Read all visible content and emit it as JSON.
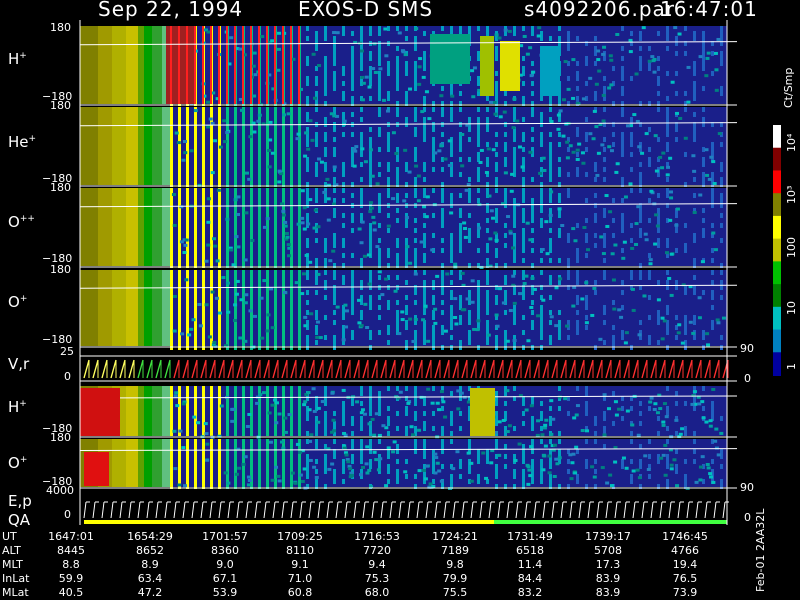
{
  "header": {
    "date": "Sep 22, 1994",
    "instrument": "EXOS-D SMS",
    "file": "s4092206.par",
    "time": "16:47:01"
  },
  "panels": {
    "h_plus": {
      "name": "H",
      "sup": "+",
      "ymax": "180",
      "ymin": "−180"
    },
    "he_plus": {
      "name": "He",
      "sup": "+",
      "ymax": "180",
      "ymin": "−180"
    },
    "o_pp": {
      "name": "O",
      "sup": "++",
      "ymax": "180",
      "ymin": "−180"
    },
    "o_plus": {
      "name": "O",
      "sup": "+",
      "ymax": "180",
      "ymin": "−180"
    },
    "vr": {
      "name": "V,r",
      "ymax": "25",
      "ymin": "0",
      "rmax": "90",
      "rmin": "0"
    },
    "h_plus2": {
      "name": "H",
      "sup": "+",
      "ymax": "180",
      "ymin": "−180"
    },
    "o_plus2": {
      "name": "O",
      "sup": "+",
      "ymax": "180",
      "ymin": "−180",
      "rmax": "90"
    },
    "ep": {
      "name1": "E,p",
      "name2": "QA",
      "ymax": "4000",
      "ymin": "0",
      "rmin": "0"
    }
  },
  "colorbar": {
    "unit": "Ct/Smp",
    "ticks": [
      "10⁴",
      "10³",
      "100",
      "10",
      "1"
    ],
    "colors": [
      "#ffffff",
      "#800000",
      "#ff0000",
      "#808000",
      "#ffff00",
      "#c0c000",
      "#00c000",
      "#008000",
      "#00c0c0",
      "#0080c0",
      "#0000a0"
    ]
  },
  "footer": {
    "rows": [
      {
        "label": "UT",
        "values": [
          "1647:01",
          "1654:29",
          "1701:57",
          "1709:25",
          "1716:53",
          "1724:21",
          "1731:49",
          "1739:17",
          "1746:45"
        ]
      },
      {
        "label": "ALT",
        "values": [
          "8445",
          "8652",
          "8360",
          "8110",
          "7720",
          "7189",
          "6518",
          "5708",
          "4766"
        ]
      },
      {
        "label": "MLT",
        "values": [
          "8.8",
          "8.9",
          "9.0",
          "9.1",
          "9.4",
          "9.8",
          "11.4",
          "17.3",
          "19.4"
        ]
      },
      {
        "label": "InLat",
        "values": [
          "59.9",
          "63.4",
          "67.1",
          "71.0",
          "75.3",
          "79.9",
          "84.4",
          "83.9",
          "76.5"
        ]
      },
      {
        "label": "MLat",
        "values": [
          "40.5",
          "47.2",
          "53.9",
          "60.8",
          "68.0",
          "75.5",
          "83.2",
          "83.9",
          "73.9"
        ]
      }
    ],
    "stamp": "Feb-01 2AA32L"
  },
  "chart_data": {
    "type": "heatmap",
    "title": "Sep 22, 1994   EXOS-D SMS",
    "x": [
      "1647:01",
      "1654:29",
      "1701:57",
      "1709:25",
      "1716:53",
      "1724:21",
      "1731:49",
      "1739:17",
      "1746:45"
    ],
    "colorbar_label": "Ct/Smp",
    "colorbar_scale": "log",
    "colorbar_range": [
      1,
      10000
    ],
    "panels": [
      "H+",
      "He+",
      "O++",
      "O+",
      "V,r",
      "H+",
      "O+",
      "E,p QA"
    ]
  }
}
